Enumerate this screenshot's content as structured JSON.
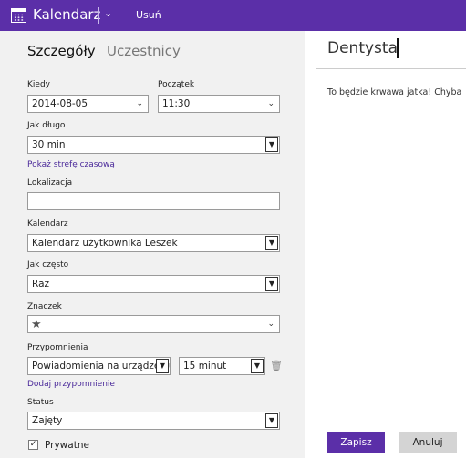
{
  "topbar": {
    "app_title": "Kalendarz",
    "chevron_icon": "chevron-down-icon",
    "delete_label": "Usuń",
    "background": "#5b2fa8"
  },
  "tabs": {
    "details": "Szczegóły",
    "attendees": "Uczestnicy"
  },
  "form": {
    "when": {
      "label": "Kiedy",
      "value": "2014-08-05"
    },
    "start": {
      "label": "Początek",
      "value": "11:30"
    },
    "duration": {
      "label": "Jak długo",
      "value": "30 min"
    },
    "timezone_link": "Pokaż strefę czasową",
    "location": {
      "label": "Lokalizacja",
      "value": ""
    },
    "calendar": {
      "label": "Kalendarz",
      "value": "Kalendarz użytkownika Leszek"
    },
    "recurrence": {
      "label": "Jak często",
      "value": "Raz"
    },
    "badge": {
      "label": "Znaczek",
      "icon": "star-icon"
    },
    "reminders": {
      "label": "Przypomnienia",
      "type_value": "Powiadomienia na urządzeniu",
      "time_value": "15 minut",
      "add_link": "Dodaj przypomnienie"
    },
    "status": {
      "label": "Status",
      "value": "Zajęty"
    },
    "private": {
      "label": "Prywatne",
      "checked": true
    }
  },
  "event": {
    "title": "Dentysta",
    "notes": "To będzie krwawa jatka! Chyba"
  },
  "buttons": {
    "save": "Zapisz",
    "cancel": "Anuluj"
  },
  "colors": {
    "accent": "#5b2fa8",
    "link": "#4b2a9a",
    "panel": "#f1f1f1"
  }
}
